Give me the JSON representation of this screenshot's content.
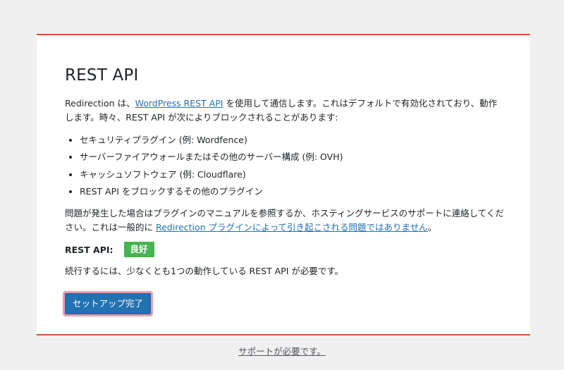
{
  "card": {
    "title": "REST API",
    "intro": {
      "before": "Redirection は、",
      "link": "WordPress REST API",
      "after": " を使用して通信します。これはデフォルトで有効化されており、動作します。時々、REST API が次によりブロックされることがあります:"
    },
    "causes": [
      "セキュリティプラグイン (例: Wordfence)",
      "サーバーファイアウォールまたはその他のサーバー構成 (例: OVH)",
      "キャッシュソフトウェア (例: Cloudflare)",
      "REST API をブロックするその他のプラグイン"
    ],
    "help": {
      "before": "問題が発生した場合はプラグインのマニュアルを参照するか、ホスティングサービスのサポートに連絡してください。これは一般的に ",
      "link": "Redirection プラグインによって引き起こされる問題ではありません",
      "after": "。"
    },
    "api_status": {
      "label": "REST API:",
      "value": "良好",
      "color": "#46b450"
    },
    "requirement": "続行するには、少なくとも1つの動作している REST API が必要です。",
    "finish_button": "セットアップ完了"
  },
  "footer": {
    "support_link": "サポートが必要です。"
  },
  "colors": {
    "accent_border": "#c9572c",
    "link": "#2271b1",
    "button": "#2271b1",
    "button_highlight": "#f29ca8",
    "background": "#f0f0f1"
  }
}
